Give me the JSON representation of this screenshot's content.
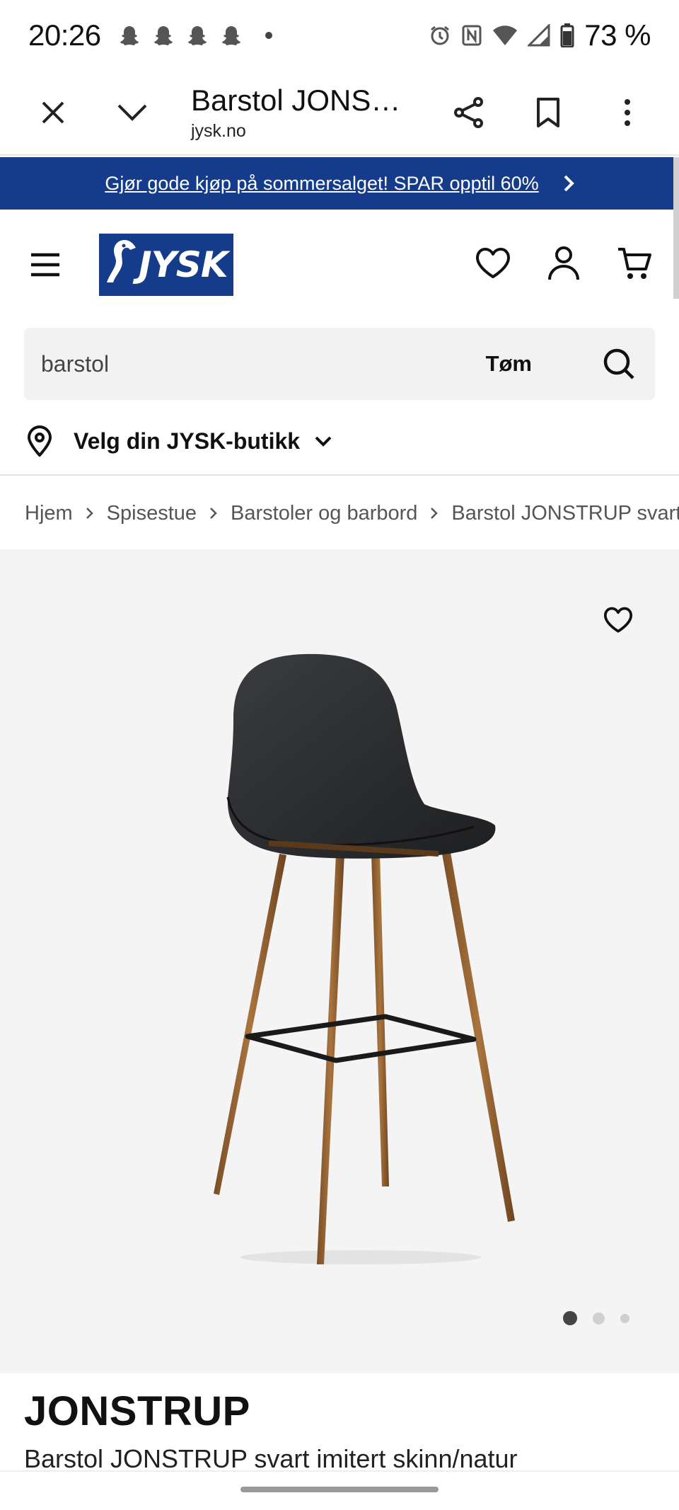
{
  "status_bar": {
    "time": "20:26",
    "battery": "73 %"
  },
  "tab_bar": {
    "title": "Barstol JONSTRUP svart imitert skinn/natur",
    "url": "jysk.no"
  },
  "promo": {
    "text": "Gjør gode kjøp på sommersalget! SPAR opptil 60%",
    "background": "#143c8a"
  },
  "header": {
    "logo_text": "JYSK"
  },
  "search": {
    "value": "barstol",
    "clear_label": "Tøm"
  },
  "store": {
    "label": "Velg din JYSK-butikk"
  },
  "breadcrumb": [
    "Hjem",
    "Spisestue",
    "Barstoler og barbord",
    "Barstol JONSTRUP svart imitert skinn/natur"
  ],
  "gallery": {
    "total_images": 3,
    "active_image": 1
  },
  "product": {
    "name": "JONSTRUP",
    "subtitle": "Barstol JONSTRUP svart imitert skinn/natur"
  }
}
